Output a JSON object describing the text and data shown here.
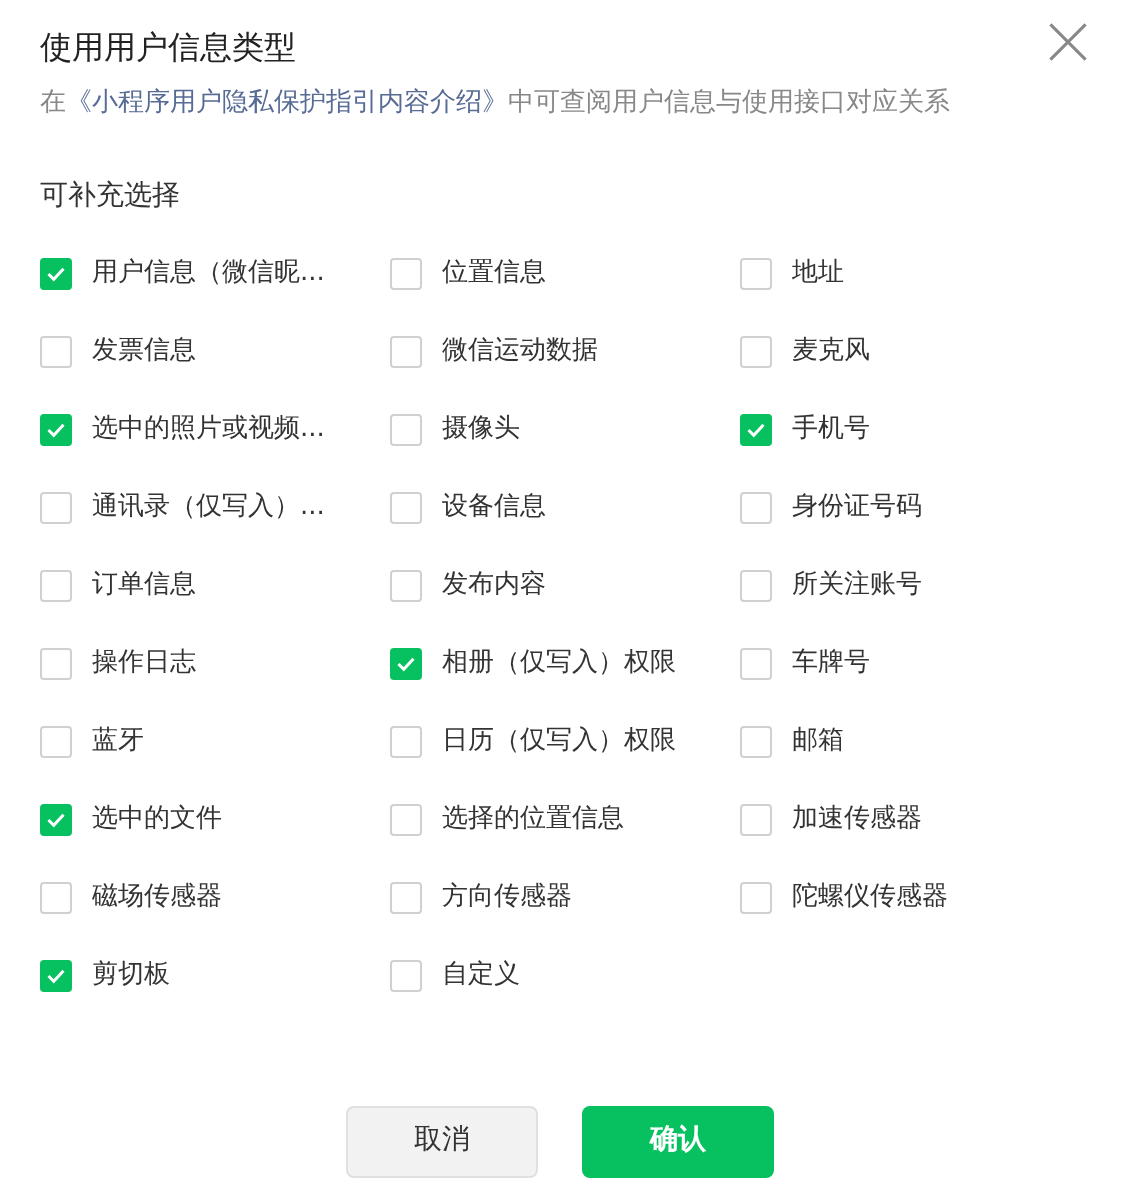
{
  "dialog": {
    "title": "使用用户信息类型",
    "intro_prefix": "在",
    "intro_link": "《小程序用户隐私保护指引内容介绍》",
    "intro_suffix": "中可查阅用户信息与使用接口对应关系"
  },
  "section_label": "可补充选择",
  "options": [
    {
      "label": "用户信息（微信昵...",
      "checked": true
    },
    {
      "label": "位置信息",
      "checked": false
    },
    {
      "label": "地址",
      "checked": false
    },
    {
      "label": "发票信息",
      "checked": false
    },
    {
      "label": "微信运动数据",
      "checked": false
    },
    {
      "label": "麦克风",
      "checked": false
    },
    {
      "label": "选中的照片或视频...",
      "checked": true
    },
    {
      "label": "摄像头",
      "checked": false
    },
    {
      "label": "手机号",
      "checked": true
    },
    {
      "label": "通讯录（仅写入）...",
      "checked": false
    },
    {
      "label": "设备信息",
      "checked": false
    },
    {
      "label": "身份证号码",
      "checked": false
    },
    {
      "label": "订单信息",
      "checked": false
    },
    {
      "label": "发布内容",
      "checked": false
    },
    {
      "label": "所关注账号",
      "checked": false
    },
    {
      "label": "操作日志",
      "checked": false
    },
    {
      "label": "相册（仅写入）权限",
      "checked": true
    },
    {
      "label": "车牌号",
      "checked": false
    },
    {
      "label": "蓝牙",
      "checked": false
    },
    {
      "label": "日历（仅写入）权限",
      "checked": false
    },
    {
      "label": "邮箱",
      "checked": false
    },
    {
      "label": "选中的文件",
      "checked": true
    },
    {
      "label": "选择的位置信息",
      "checked": false
    },
    {
      "label": "加速传感器",
      "checked": false
    },
    {
      "label": "磁场传感器",
      "checked": false
    },
    {
      "label": "方向传感器",
      "checked": false
    },
    {
      "label": "陀螺仪传感器",
      "checked": false
    },
    {
      "label": "剪切板",
      "checked": true
    },
    {
      "label": "自定义",
      "checked": false
    }
  ],
  "buttons": [
    {
      "label": "取消",
      "kind": "secondary"
    },
    {
      "label": "确认",
      "kind": "primary"
    }
  ]
}
